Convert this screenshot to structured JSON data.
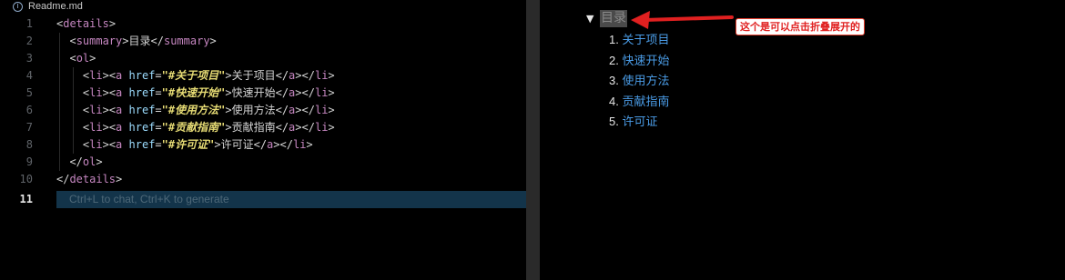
{
  "tab": {
    "icon": "info-icon",
    "title": "Readme.md"
  },
  "editor": {
    "line_numbers": [
      "1",
      "2",
      "3",
      "4",
      "5",
      "6",
      "7",
      "8",
      "9",
      "10",
      "11"
    ],
    "active_line": "11",
    "lines": [
      {
        "indent": "",
        "open_lt": "<",
        "tag": "details",
        "close_gt": ">"
      },
      {
        "indent": "  ",
        "open_lt": "<",
        "tag": "summary",
        "close_gt": ">",
        "text": "目录",
        "end_lt": "</",
        "end_tag": "summary",
        "end_gt": ">"
      },
      {
        "indent": "  ",
        "open_lt": "<",
        "tag": "ol",
        "close_gt": ">"
      },
      {
        "indent": "    ",
        "li": "li",
        "a": "a",
        "attr": "href",
        "eq": "=",
        "href": "\"#关于项目\"",
        "text": "关于项目"
      },
      {
        "indent": "    ",
        "li": "li",
        "a": "a",
        "attr": "href",
        "eq": "=",
        "href": "\"#快速开始\"",
        "text": "快速开始"
      },
      {
        "indent": "    ",
        "li": "li",
        "a": "a",
        "attr": "href",
        "eq": "=",
        "href": "\"#使用方法\"",
        "text": "使用方法"
      },
      {
        "indent": "    ",
        "li": "li",
        "a": "a",
        "attr": "href",
        "eq": "=",
        "href": "\"#贡献指南\"",
        "text": "贡献指南"
      },
      {
        "indent": "    ",
        "li": "li",
        "a": "a",
        "attr": "href",
        "eq": "=",
        "href": "\"#许可证\"",
        "text": "许可证"
      },
      {
        "indent": "  ",
        "open_lt": "</",
        "tag": "ol",
        "close_gt": ">"
      },
      {
        "indent": "",
        "open_lt": "</",
        "tag": "details",
        "close_gt": ">"
      }
    ],
    "hint": "Ctrl+L to chat, Ctrl+K to generate"
  },
  "preview": {
    "toggle_icon": "triangle-down-icon",
    "toggle_glyph": "▼",
    "summary": "目录",
    "items": [
      {
        "num": "1.",
        "label": "关于项目"
      },
      {
        "num": "2.",
        "label": "快速开始"
      },
      {
        "num": "3.",
        "label": "使用方法"
      },
      {
        "num": "4.",
        "label": "贡献指南"
      },
      {
        "num": "5.",
        "label": "许可证"
      }
    ],
    "annotation": "这个是可以点击折叠展开的",
    "annotation_color": "#e02020"
  }
}
